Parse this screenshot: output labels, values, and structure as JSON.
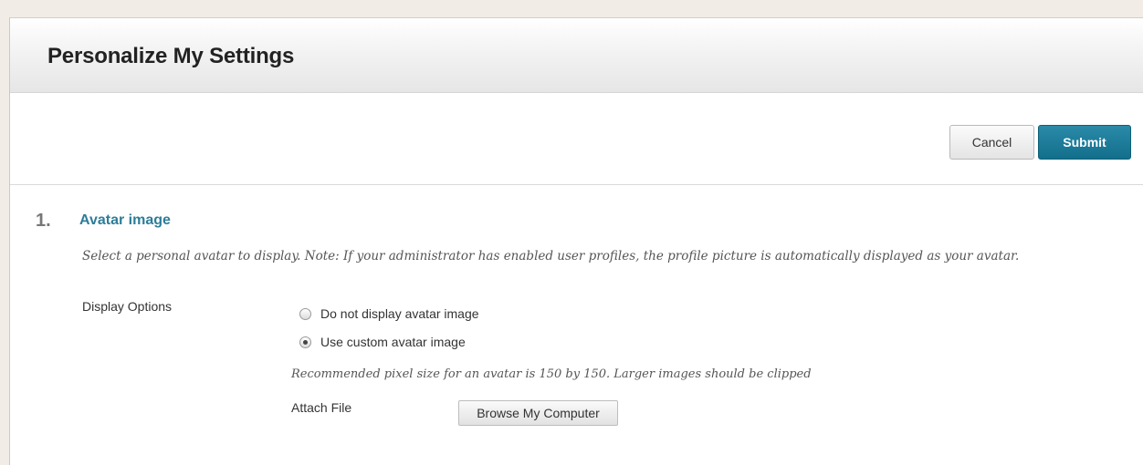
{
  "page": {
    "title": "Personalize My Settings"
  },
  "actions": {
    "cancel_label": "Cancel",
    "submit_label": "Submit"
  },
  "section": {
    "number": "1.",
    "title": "Avatar image",
    "instructions": "Select a personal avatar to display. Note: If your administrator has enabled user profiles, the profile picture is automatically displayed as your avatar.",
    "display_options_label": "Display Options",
    "options": [
      {
        "label": "Do not display avatar image",
        "selected": false
      },
      {
        "label": "Use custom avatar image",
        "selected": true
      }
    ],
    "hint": "Recommended pixel size for an avatar is 150 by 150. Larger images should be clipped",
    "attach_file_label": "Attach File",
    "browse_label": "Browse My Computer"
  },
  "colors": {
    "accent": "#2d7d99",
    "submit_bg": "#136f8c",
    "page_bg": "#f1ede6"
  }
}
